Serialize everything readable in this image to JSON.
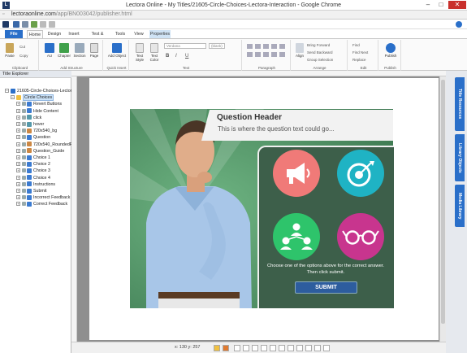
{
  "window": {
    "title": "Lectora Online - My Titles/21605-Circle-Choices-Lectora-Interaction - Google Chrome",
    "url_host": "lectoraonline.com",
    "url_path": "/app/BN003042/publisher.html",
    "app_letter": "L"
  },
  "ribbon": {
    "tabs": [
      "File",
      "Home",
      "Design",
      "Insert",
      "Test & Survey",
      "Tools",
      "View",
      "Properties"
    ],
    "groups": {
      "clipboard": {
        "label": "Clipboard",
        "paste": "Paste",
        "cut": "Cut",
        "copy": "Copy"
      },
      "add_structure": {
        "label": "Add Structure",
        "au": "AU",
        "chapter": "Chapter",
        "section": "Section",
        "page": "Page"
      },
      "quick_insert": {
        "label": "Quick Insert",
        "add_object": "Add Object"
      },
      "text": {
        "label": "Text",
        "text_style": "Text Style",
        "text_color": "Text Color",
        "font": "Verdana",
        "size": "(blank)",
        "b": "B",
        "i": "I",
        "u": "U"
      },
      "paragraph": {
        "label": "Paragraph"
      },
      "arrange": {
        "label": "Arrange",
        "align": "Align",
        "bring_forward": "Bring Forward",
        "send_backward": "Send Backward",
        "group_selection": "Group Selection"
      },
      "edit": {
        "label": "Edit",
        "find": "Find",
        "find_next": "Find Next",
        "replace": "Replace"
      },
      "publish": {
        "label": "Publish",
        "publish_btn": "Publish"
      }
    }
  },
  "explorer": {
    "header": "Title Explorer",
    "items": [
      {
        "label": "21605-Circle-Choices-Lectora",
        "level": 0,
        "color": "#2a6fc9"
      },
      {
        "label": "Circle Choices",
        "level": 1,
        "color": "#f0c040",
        "selected": true
      },
      {
        "label": "Revert Buttons",
        "level": 2,
        "color": "#3b7bd1"
      },
      {
        "label": "Hide Content",
        "level": 2,
        "color": "#3b7bd1"
      },
      {
        "label": "click",
        "level": 2,
        "color": "#59a"
      },
      {
        "label": "hover",
        "level": 2,
        "color": "#59a"
      },
      {
        "label": "720x540_bg",
        "level": 2,
        "color": "#c84"
      },
      {
        "label": "Question",
        "level": 2,
        "color": "#3b7bd1"
      },
      {
        "label": "720x540_RoundedR",
        "level": 2,
        "color": "#c84"
      },
      {
        "label": "Question_Guide",
        "level": 2,
        "color": "#c84"
      },
      {
        "label": "Choice 1",
        "level": 2,
        "color": "#3b7bd1"
      },
      {
        "label": "Choice 2",
        "level": 2,
        "color": "#3b7bd1"
      },
      {
        "label": "Choice 3",
        "level": 2,
        "color": "#3b7bd1"
      },
      {
        "label": "Choice 4",
        "level": 2,
        "color": "#3b7bd1"
      },
      {
        "label": "Instructions",
        "level": 2,
        "color": "#3b7bd1"
      },
      {
        "label": "Submit",
        "level": 2,
        "color": "#3b7bd1"
      },
      {
        "label": "Incorrect Feedback",
        "level": 2,
        "color": "#3b7bd1"
      },
      {
        "label": "Correct Feedback",
        "level": 2,
        "color": "#3b7bd1"
      }
    ]
  },
  "right_tabs": [
    "Title Resources",
    "Library Objects",
    "Media Library"
  ],
  "slide": {
    "question_header": "Question Header",
    "question_text": "This is where the question text could go...",
    "instructions": "Choose one of the options above for the correct answer. Then click submit.",
    "submit": "SUBMIT",
    "circles": [
      {
        "name": "megaphone",
        "color": "#f07a78"
      },
      {
        "name": "target",
        "color": "#1fb3c4"
      },
      {
        "name": "people",
        "color": "#2ec46b"
      },
      {
        "name": "glasses",
        "color": "#c8358e"
      }
    ]
  },
  "status": {
    "coords": "x: 130   y: 257"
  }
}
